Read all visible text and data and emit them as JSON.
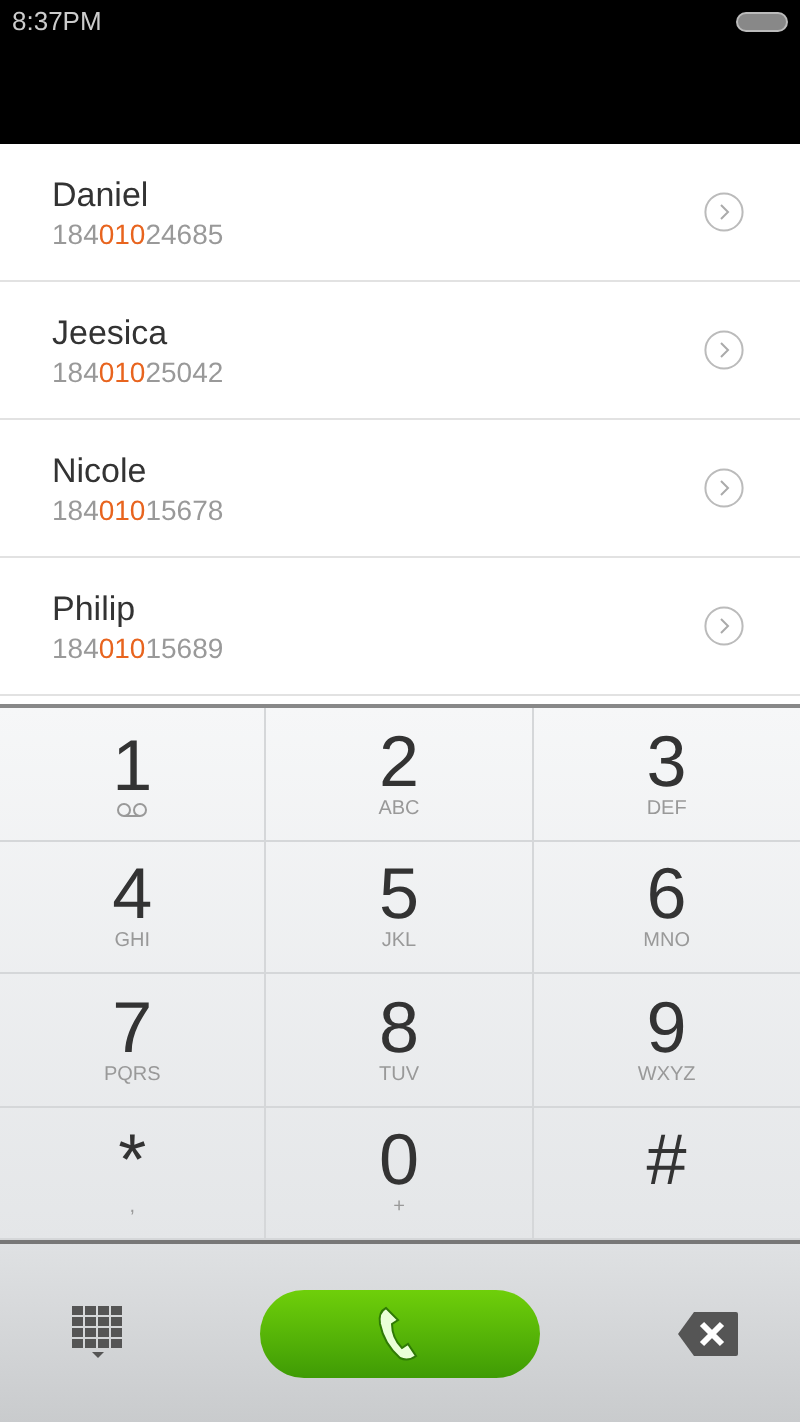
{
  "status_bar": {
    "time": "8:37PM"
  },
  "contacts": [
    {
      "name": "Daniel",
      "number": [
        {
          "text": "184",
          "highlight": false
        },
        {
          "text": "010",
          "highlight": true
        },
        {
          "text": "24685",
          "highlight": false
        }
      ]
    },
    {
      "name": "Jeesica",
      "number": [
        {
          "text": "184",
          "highlight": false
        },
        {
          "text": "010",
          "highlight": true
        },
        {
          "text": "25042",
          "highlight": false
        }
      ]
    },
    {
      "name": "Nicole",
      "number": [
        {
          "text": "184",
          "highlight": false
        },
        {
          "text": "010",
          "highlight": true
        },
        {
          "text": "15678",
          "highlight": false
        }
      ]
    },
    {
      "name": "Philip",
      "number": [
        {
          "text": "184",
          "highlight": false
        },
        {
          "text": "010",
          "highlight": true
        },
        {
          "text": "15689",
          "highlight": false
        }
      ]
    }
  ],
  "keypad": [
    {
      "digit": "1",
      "kind": "voicemail"
    },
    {
      "digit": "2",
      "kind": "letters",
      "letters": "ABC"
    },
    {
      "digit": "3",
      "kind": "letters",
      "letters": "DEF"
    },
    {
      "digit": "4",
      "kind": "letters",
      "letters": "GHI"
    },
    {
      "digit": "5",
      "kind": "letters",
      "letters": "JKL"
    },
    {
      "digit": "6",
      "kind": "letters",
      "letters": "MNO"
    },
    {
      "digit": "7",
      "kind": "letters",
      "letters": "PQRS"
    },
    {
      "digit": "8",
      "kind": "letters",
      "letters": "TUV"
    },
    {
      "digit": "9",
      "kind": "letters",
      "letters": "WXYZ"
    },
    {
      "digit": "*",
      "kind": "letters",
      "letters": ","
    },
    {
      "digit": "0",
      "kind": "letters",
      "letters": "+"
    },
    {
      "digit": "#",
      "kind": "plain"
    }
  ]
}
